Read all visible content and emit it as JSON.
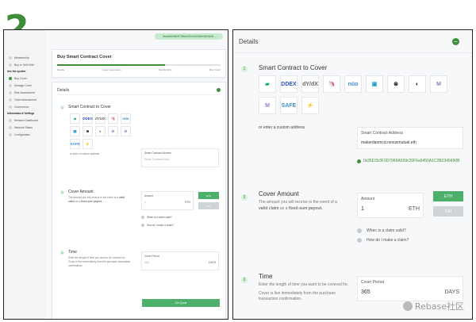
{
  "step_number": "2",
  "app": {
    "address_pill": "0xad4d0b5fd3f7986a4332e1f02f44e4513a08...",
    "page_title": "Buy Smart Contract Cover",
    "progress_fraction": 0.66,
    "progress_steps": [
      "Details",
      "Quote Generation",
      "Membership",
      "Buy Cover"
    ]
  },
  "sidebar": {
    "items": [
      {
        "label": "Membership",
        "section": false
      },
      {
        "label": "Buy or Sell NXM",
        "section": false
      },
      {
        "label": "Use the system",
        "section": true
      },
      {
        "label": "Buy Cover",
        "section": false,
        "active": true
      },
      {
        "label": "Manage Cover",
        "section": false
      },
      {
        "label": "Risk Assessment",
        "section": false
      },
      {
        "label": "Claim Assessment",
        "section": false
      },
      {
        "label": "Governance",
        "section": false
      },
      {
        "label": "Information & Settings",
        "section": true
      },
      {
        "label": "Member Dashboard",
        "section": false
      },
      {
        "label": "Network Status",
        "section": false
      },
      {
        "label": "Configuration",
        "section": false
      }
    ]
  },
  "details": {
    "header": "Details",
    "toggle_symbol": "−",
    "section1": {
      "number": "1",
      "title": "Smart Contract to Cover",
      "logos": [
        {
          "name": "compound",
          "label": "▰",
          "bg": "#ffffff",
          "fg": "#00b05a"
        },
        {
          "name": "dydx",
          "label": "DDEX",
          "bg": "#ffffff",
          "fg": "#2a56c6"
        },
        {
          "name": "0x",
          "label": "dY/dX",
          "bg": "#ffffff",
          "fg": "#666666"
        },
        {
          "name": "uniswap",
          "label": "🦄",
          "bg": "#ffffff",
          "fg": "#d63384"
        },
        {
          "name": "nuo",
          "label": "nüo",
          "bg": "#ffffff",
          "fg": "#3c8fd1"
        },
        {
          "name": "balancer",
          "label": "▣",
          "bg": "#ffffff",
          "fg": "#1e9bd6"
        },
        {
          "name": "gnosis",
          "label": "⊗",
          "bg": "#ffffff",
          "fg": "#111111"
        },
        {
          "name": "dharma",
          "label": "◐",
          "bg": "#ffffff",
          "fg": "#111111"
        },
        {
          "name": "maker",
          "label": "M",
          "bg": "#ffffff",
          "fg": "#9a7fc7"
        },
        {
          "name": "maker-dai",
          "label": "M",
          "bg": "#ffffff",
          "fg": "#9a7fc7"
        },
        {
          "name": "safe",
          "label": "SAFE",
          "bg": "#ffffff",
          "fg": "#3c8fd1"
        },
        {
          "name": "fulcrum",
          "label": "⚡",
          "bg": "#ffffff",
          "fg": "#2a8ec6"
        }
      ],
      "or_enter": "or enter a custom address",
      "address_label": "Smart Contract Address",
      "address_value_left": "Smart Contract Addr...",
      "address_value_right": "makerdaomcd.nexusmutual.eth",
      "resolved_address": "0x35D1b3F3D7966A509c20F6a6450A1C2B2349490B"
    },
    "section2": {
      "number": "2",
      "title": "Cover Amount",
      "desc_prefix": "The amount you will receive in the event of a ",
      "desc_valid": "valid claim",
      "desc_mid": " as a ",
      "desc_payout": "fixed-sum payout.",
      "amount_label": "Amount",
      "amount_value": "1",
      "amount_unit": "ETH",
      "btn_eth": "ETH",
      "btn_dai": "DAI",
      "q1": "When is a claim valid?",
      "q2": "How do I make a claim?"
    },
    "section3": {
      "number": "3",
      "title": "Time",
      "desc1": "Enter the length of time you want to be covered for.",
      "desc2": "Cover is live immediately from the purchase transaction confirmation.",
      "period_label": "Cover Period",
      "period_value": "365",
      "period_unit": "DAYS"
    },
    "get_quote_label": "Get Quote"
  },
  "watermark": "Rebase社区"
}
